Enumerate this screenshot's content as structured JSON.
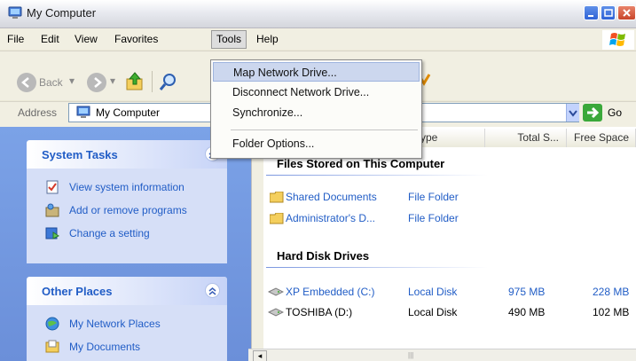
{
  "window": {
    "title": "My Computer"
  },
  "menubar": {
    "items": [
      "File",
      "Edit",
      "View",
      "Favorites",
      "Tools",
      "Help"
    ]
  },
  "toolbar": {
    "back_label": "Back"
  },
  "address": {
    "label": "Address",
    "value": "My Computer",
    "go_label": "Go"
  },
  "tools_menu": {
    "items": [
      "Map Network Drive...",
      "Disconnect Network Drive...",
      "Synchronize...",
      "Folder Options..."
    ]
  },
  "system_tasks": {
    "title": "System Tasks",
    "items": [
      "View system information",
      "Add or remove programs",
      "Change a setting"
    ]
  },
  "other_places": {
    "title": "Other Places",
    "items": [
      "My Network Places",
      "My Documents"
    ]
  },
  "columns": [
    "ype",
    "Total S...",
    "Free Space"
  ],
  "groups": {
    "files_title": "Files Stored on This Computer",
    "files": [
      {
        "name": "Shared Documents",
        "type": "File Folder"
      },
      {
        "name": "Administrator's D...",
        "type": "File Folder"
      }
    ],
    "drives_title": "Hard Disk Drives",
    "drives": [
      {
        "name": "XP Embedded (C:)",
        "type": "Local Disk",
        "total": "975 MB",
        "free": "228 MB"
      },
      {
        "name": "TOSHIBA (D:)",
        "type": "Local Disk",
        "total": "490 MB",
        "free": "102 MB"
      }
    ]
  },
  "colors": {
    "link": "#215dc6",
    "task_pane": "#7ba2e7",
    "menu_highlight": "#ccd7ee"
  }
}
